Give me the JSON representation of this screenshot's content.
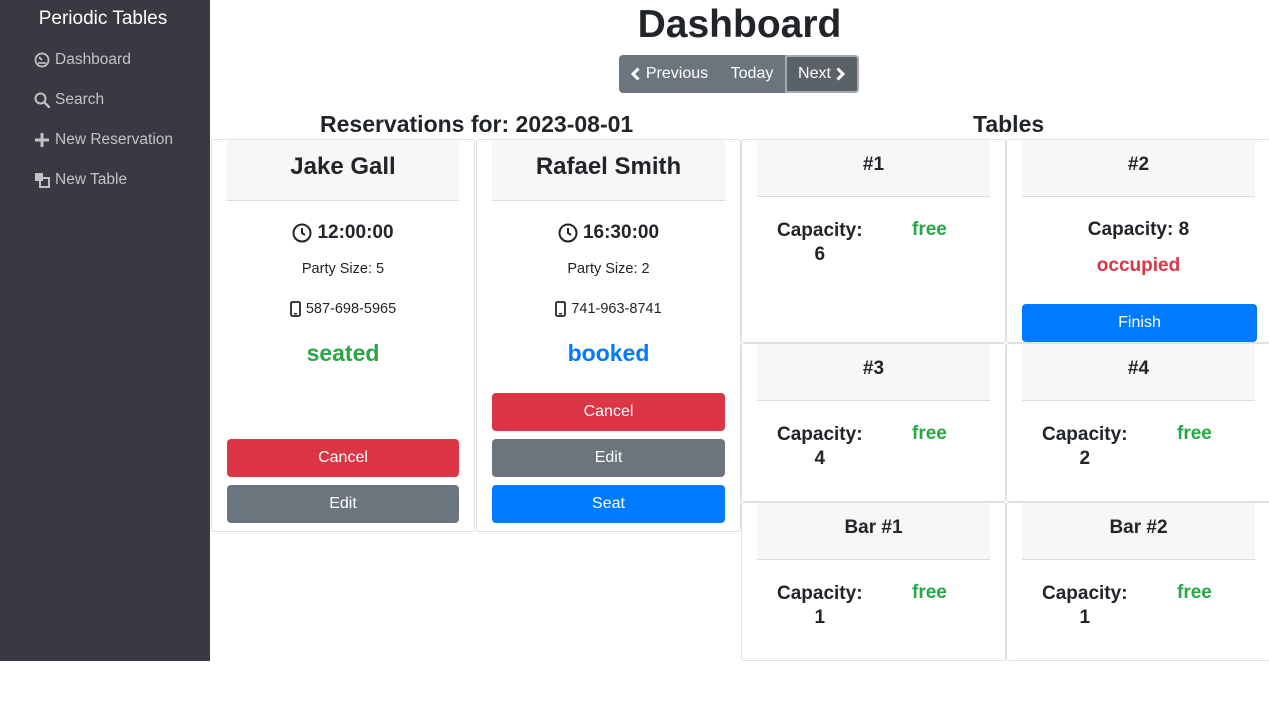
{
  "sidebar": {
    "brand": "Periodic Tables",
    "items": [
      {
        "label": "Dashboard",
        "icon": "dashboard-icon"
      },
      {
        "label": "Search",
        "icon": "search-icon"
      },
      {
        "label": "New Reservation",
        "icon": "plus-icon"
      },
      {
        "label": "New Table",
        "icon": "table-icon"
      }
    ]
  },
  "header": {
    "title": "Dashboard",
    "nav": {
      "previous": "Previous",
      "today": "Today",
      "next": "Next"
    }
  },
  "reservations": {
    "heading": "Reservations for: 2023-08-01",
    "items": [
      {
        "name": "Jake Gall",
        "time": "12:00:00",
        "party": "Party Size: 5",
        "phone": "587-698-5965",
        "status": "seated",
        "buttons": [
          "Cancel",
          "Edit"
        ]
      },
      {
        "name": "Rafael Smith",
        "time": "16:30:00",
        "party": "Party Size: 2",
        "phone": "741-963-8741",
        "status": "booked",
        "buttons": [
          "Cancel",
          "Edit",
          "Seat"
        ]
      }
    ]
  },
  "tables": {
    "heading": "Tables",
    "capacity_label": "Capacity:",
    "finish_label": "Finish",
    "items": [
      {
        "name": "#1",
        "capacity": "6",
        "status": "free"
      },
      {
        "name": "#2",
        "capacity": "8",
        "status": "occupied"
      },
      {
        "name": "#3",
        "capacity": "4",
        "status": "free"
      },
      {
        "name": "#4",
        "capacity": "2",
        "status": "free"
      },
      {
        "name": "Bar #1",
        "capacity": "1",
        "status": "free"
      },
      {
        "name": "Bar #2",
        "capacity": "1",
        "status": "free"
      }
    ]
  },
  "colors": {
    "sidebar_bg": "#393a41",
    "danger": "#dc3545",
    "secondary": "#6c757d",
    "primary": "#007bff",
    "success": "#28a745"
  }
}
